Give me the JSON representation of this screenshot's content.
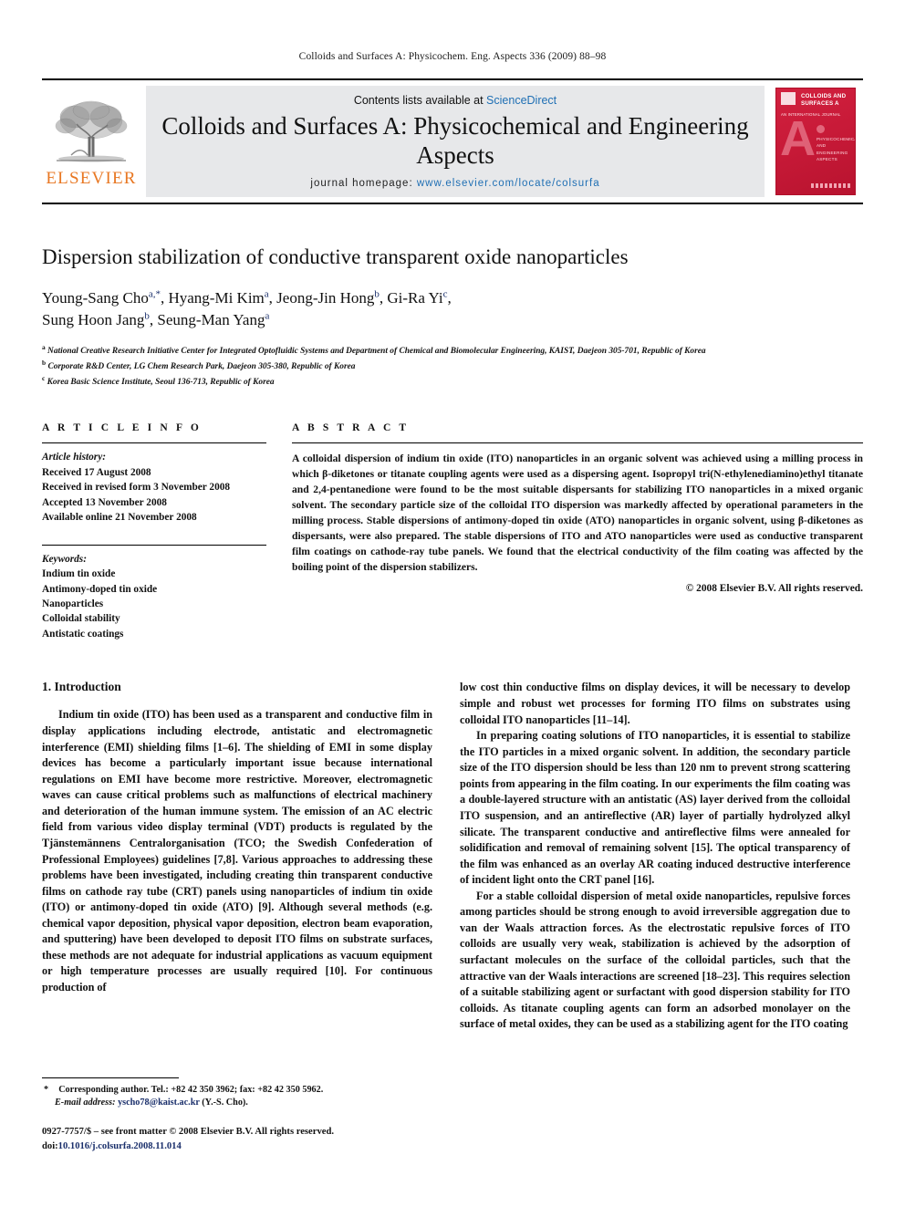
{
  "running_head": "Colloids and Surfaces A: Physicochem. Eng. Aspects 336 (2009) 88–98",
  "masthead": {
    "contents_prefix": "Contents lists available at ",
    "sciencedirect": "ScienceDirect",
    "journal_title": "Colloids and Surfaces A: Physicochemical and Engineering Aspects",
    "homepage_label": "journal homepage: ",
    "homepage_url": "www.elsevier.com/locate/colsurfa",
    "publisher": "ELSEVIER",
    "cover": {
      "top_text": "COLLOIDS AND SURFACES A",
      "sub_text": "AN INTERNATIONAL JOURNAL",
      "letter": "A",
      "mid_text": "PHYSICOCHEMICAL AND ENGINEERING ASPECTS",
      "accent_color": "#c81a38"
    },
    "link_color": "#1f6fb4"
  },
  "article": {
    "title": "Dispersion stabilization of conductive transparent oxide nanoparticles",
    "authors_line_1": "Young-Sang Cho",
    "authors": "Young-Sang Cho a,*, Hyang-Mi Kim a, Jeong-Jin Hong b, Gi-Ra Yi c, Sung Hoon Jang b, Seung-Man Yang a",
    "affiliations": [
      "National Creative Research Initiative Center for Integrated Optofluidic Systems and Department of Chemical and Biomolecular Engineering, KAIST, Daejeon 305-701, Republic of Korea",
      "Corporate R&D Center, LG Chem Research Park, Daejeon 305-380, Republic of Korea",
      "Korea Basic Science Institute, Seoul 136-713, Republic of Korea"
    ],
    "affiliation_markers": [
      "a",
      "b",
      "c"
    ]
  },
  "article_info": {
    "heading": "A R T I C L E   I N F O",
    "history_label": "Article history:",
    "history": [
      "Received 17 August 2008",
      "Received in revised form 3 November 2008",
      "Accepted 13 November 2008",
      "Available online 21 November 2008"
    ],
    "keywords_label": "Keywords:",
    "keywords": [
      "Indium tin oxide",
      "Antimony-doped tin oxide",
      "Nanoparticles",
      "Colloidal stability",
      "Antistatic coatings"
    ]
  },
  "abstract": {
    "heading": "A B S T R A C T",
    "text": "A colloidal dispersion of indium tin oxide (ITO) nanoparticles in an organic solvent was achieved using a milling process in which β-diketones or titanate coupling agents were used as a dispersing agent. Isopropyl tri(N-ethylenediamino)ethyl titanate and 2,4-pentanedione were found to be the most suitable dispersants for stabilizing ITO nanoparticles in a mixed organic solvent. The secondary particle size of the colloidal ITO dispersion was markedly affected by operational parameters in the milling process. Stable dispersions of antimony-doped tin oxide (ATO) nanoparticles in organic solvent, using β-diketones as dispersants, were also prepared. The stable dispersions of ITO and ATO nanoparticles were used as conductive transparent film coatings on cathode-ray tube panels. We found that the electrical conductivity of the film coating was affected by the boiling point of the dispersion stabilizers.",
    "copyright": "© 2008 Elsevier B.V. All rights reserved."
  },
  "body": {
    "section_title": "1.  Introduction",
    "left_paragraphs": [
      "Indium tin oxide (ITO) has been used as a transparent and conductive film in display applications including electrode, antistatic and electromagnetic interference (EMI) shielding films [1–6]. The shielding of EMI in some display devices has become a particularly important issue because international regulations on EMI have become more restrictive. Moreover, electromagnetic waves can cause critical problems such as malfunctions of electrical machinery and deterioration of the human immune system. The emission of an AC electric field from various video display terminal (VDT) products is regulated by the Tjänstemännens Centralorganisation (TCO; the Swedish Confederation of Professional Employees) guidelines [7,8]. Various approaches to addressing these problems have been investigated, including creating thin transparent conductive films on cathode ray tube (CRT) panels using nanoparticles of indium tin oxide (ITO) or antimony-doped tin oxide (ATO) [9]. Although several methods (e.g. chemical vapor deposition, physical vapor deposition, electron beam evaporation, and sputtering) have been developed to deposit ITO films on substrate surfaces, these methods are not adequate for industrial applications as vacuum equipment or high temperature processes are usually required [10]. For continuous production of"
    ],
    "right_paragraphs": [
      "low cost thin conductive films on display devices, it will be necessary to develop simple and robust wet processes for forming ITO films on substrates using colloidal ITO nanoparticles [11–14].",
      "In preparing coating solutions of ITO nanoparticles, it is essential to stabilize the ITO particles in a mixed organic solvent. In addition, the secondary particle size of the ITO dispersion should be less than 120 nm to prevent strong scattering points from appearing in the film coating. In our experiments the film coating was a double-layered structure with an antistatic (AS) layer derived from the colloidal ITO suspension, and an antireflective (AR) layer of partially hydrolyzed alkyl silicate. The transparent conductive and antireflective films were annealed for solidification and removal of remaining solvent [15]. The optical transparency of the film was enhanced as an overlay AR coating induced destructive interference of incident light onto the CRT panel [16].",
      "For a stable colloidal dispersion of metal oxide nanoparticles, repulsive forces among particles should be strong enough to avoid irreversible aggregation due to van der Waals attraction forces. As the electrostatic repulsive forces of ITO colloids are usually very weak, stabilization is achieved by the adsorption of surfactant molecules on the surface of the colloidal particles, such that the attractive van der Waals interactions are screened [18–23]. This requires selection of a suitable stabilizing agent or surfactant with good dispersion stability for ITO colloids. As titanate coupling agents can form an adsorbed monolayer on the surface of metal oxides, they can be used as a stabilizing agent for the ITO coating"
    ]
  },
  "footnote": {
    "corresponding": "Corresponding author. Tel.: +82 42 350 3962; fax: +82 42 350 5962.",
    "email_label": "E-mail address:",
    "email": "yscho78@kaist.ac.kr",
    "email_suffix": "(Y.-S. Cho).",
    "issn_line": "0927-7757/$ – see front matter © 2008 Elsevier B.V. All rights reserved.",
    "doi_label": "doi:",
    "doi_value": "10.1016/j.colsurfa.2008.11.014"
  }
}
